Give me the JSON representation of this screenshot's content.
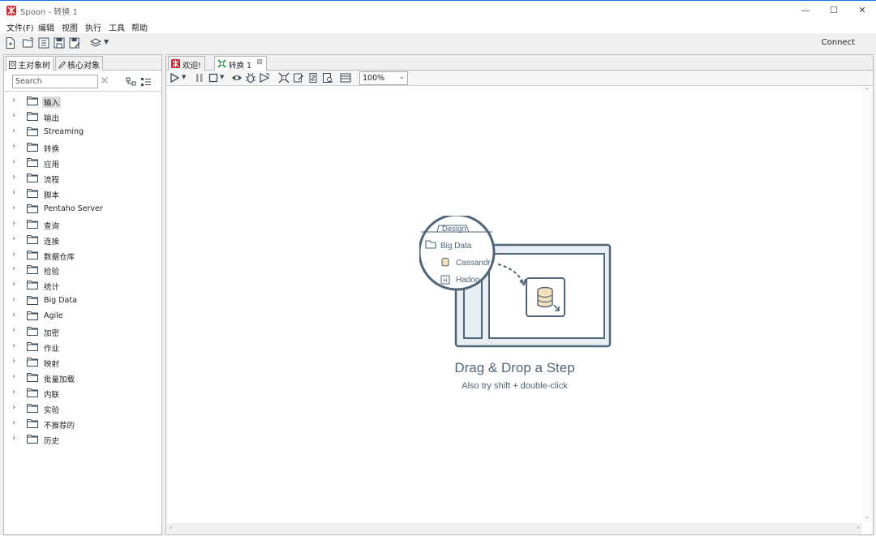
{
  "window": {
    "title": "Spoon - 转换 1",
    "controls": {
      "minimize": "—",
      "maximize": "☐",
      "close": "✕"
    }
  },
  "menu": [
    "文件(F)",
    "编辑",
    "视图",
    "执行",
    "工具",
    "帮助"
  ],
  "toolbar": {
    "connect_label": "Connect"
  },
  "left_panel": {
    "tabs": [
      "主对象树",
      "核心对象"
    ],
    "search_placeholder": "Search",
    "tree": [
      "输入",
      "输出",
      "Streaming",
      "转换",
      "应用",
      "流程",
      "脚本",
      "Pentaho Server",
      "查询",
      "连接",
      "数据仓库",
      "检验",
      "统计",
      "Big Data",
      "Agile",
      "加密",
      "作业",
      "映射",
      "批量加载",
      "内联",
      "实验",
      "不推荐的",
      "历史"
    ],
    "selected_index": 0
  },
  "main": {
    "tabs": [
      {
        "label": "欢迎!"
      },
      {
        "label": "转换 1"
      }
    ],
    "zoom": "100%",
    "illustration": {
      "tab_label": "Design",
      "folder_label": "Big Data",
      "items": [
        "Cassandr",
        "Hadoo"
      ]
    },
    "empty_title": "Drag & Drop a Step",
    "empty_subtitle": "Also try shift + double-click"
  },
  "colors": {
    "accent_red": "#d9232f",
    "accent_green": "#2e9e5b",
    "illustration_stroke": "#4f6578",
    "illustration_fill": "#e9eef3"
  }
}
